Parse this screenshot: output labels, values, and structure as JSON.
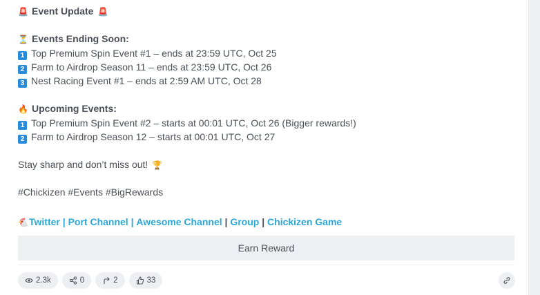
{
  "post": {
    "title": "Event Update",
    "ending_header": "Events Ending Soon:",
    "ending_items": [
      {
        "num": "1",
        "text": "Top Premium Spin Event #1 – ends at 23:59 UTC, Oct 25"
      },
      {
        "num": "2",
        "text": "Farm to Airdrop Season 11 – ends at 23:59 UTC, Oct 26"
      },
      {
        "num": "3",
        "text": "Nest Racing Event #1 – ends at 2:59 AM UTC, Oct 28"
      }
    ],
    "upcoming_header": "Upcoming Events:",
    "upcoming_items": [
      {
        "num": "1",
        "text": "Top Premium Spin Event #2 – starts at 00:01 UTC, Oct 26 (Bigger rewards!)"
      },
      {
        "num": "2",
        "text": "Farm to Airdrop Season 12 – starts at 00:01 UTC, Oct 27"
      }
    ],
    "closing": "Stay sharp and don’t miss out!",
    "hashtags": "#Chickizen #Events #BigRewards",
    "links": {
      "twitter": "Twitter",
      "port_channel": "Port Channel",
      "awesome_channel": "Awesome Channel",
      "group": "Group",
      "game": "Chickizen Game",
      "separator": "|"
    }
  },
  "reward_button": {
    "label": "Earn Reward"
  },
  "stats": {
    "views": "2.3k",
    "shares": "0",
    "forwards": "2",
    "likes": "33"
  },
  "icons": {
    "siren": "police-siren-icon",
    "hourglass": "hourglass-icon",
    "fire": "fire-icon",
    "trophy": "trophy-icon",
    "chicken": "chicken-icon",
    "eye": "eye-icon",
    "share": "share-icon",
    "forward": "forward-icon",
    "thumb": "thumbs-up-icon",
    "link": "link-icon"
  },
  "colors": {
    "link": "#2aa7d6",
    "number_badge": "#2a8bd8",
    "pill_bg": "#edeff2",
    "text": "#4a4f57"
  }
}
